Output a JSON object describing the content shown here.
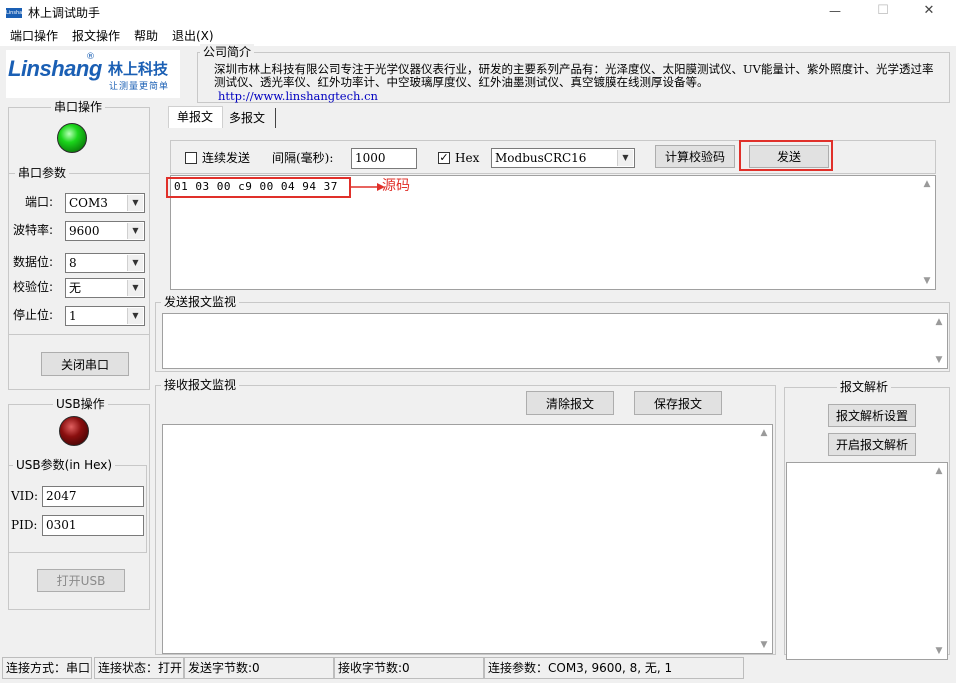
{
  "window": {
    "title": "林上调试助手",
    "logo_tiny": "Linshang",
    "controls": {
      "minimize": "—",
      "maximize": "☐",
      "close": "✕"
    }
  },
  "menu": {
    "items": [
      "端口操作",
      "报文操作",
      "帮助",
      "退出(X)"
    ]
  },
  "brand": {
    "logo_text": "Linshang",
    "registered": "®",
    "cn_name": "林上科技",
    "slogan": "让测量更简单"
  },
  "company": {
    "group_title": "公司简介",
    "text": "深圳市林上科技有限公司专注于光学仪器仪表行业，研发的主要系列产品有：光泽度仪、太阳膜测试仪、UV能量计、紫外照度计、光学透过率测试仪、透光率仪、红外功率计、中空玻璃厚度仪、红外油墨测试仪、真空镀膜在线测厚设备等。",
    "url": "http://www.linshangtech.cn"
  },
  "serial": {
    "group_title": "串口操作",
    "params_title": "串口参数",
    "led_color": "#1bd61b",
    "fields": [
      {
        "label": "端口:",
        "value": "COM3"
      },
      {
        "label": "波特率:",
        "value": "9600"
      },
      {
        "label": "数据位:",
        "value": "8"
      },
      {
        "label": "校验位:",
        "value": "无"
      },
      {
        "label": "停止位:",
        "value": "1"
      }
    ],
    "close_button": "关闭串口"
  },
  "usb": {
    "group_title": "USB操作",
    "params_title": "USB参数(in Hex)",
    "led_color": "#8a0f0f",
    "vid_label": "VID:",
    "vid_value": "2047",
    "pid_label": "PID:",
    "pid_value": "0301",
    "open_button": "打开USB"
  },
  "tabs": {
    "items": [
      "单报文",
      "多报文"
    ],
    "active": 0
  },
  "send_panel": {
    "continuous_label": "连续发送",
    "continuous_checked": false,
    "interval_label": "间隔(毫秒):",
    "interval_value": "1000",
    "hex_label": "Hex",
    "hex_checked": true,
    "crc_mode": "ModbusCRC16",
    "calc_button": "计算校验码",
    "send_button": "发送",
    "source_text": "01 03 00 c9 00 04 94 37",
    "annotation": "源码",
    "annotation_color": "#e0302a"
  },
  "send_monitor": {
    "title": "发送报文监视"
  },
  "recv_monitor": {
    "title": "接收报文监视",
    "clear_button": "清除报文",
    "save_button": "保存报文"
  },
  "parse": {
    "title": "报文解析",
    "settings_button": "报文解析设置",
    "enable_button": "开启报文解析"
  },
  "status": {
    "conn_mode": "连接方式：串口",
    "conn_state": "连接状态：打开",
    "send_bytes": "发送字节数:0",
    "recv_bytes": "接收字节数:0",
    "conn_params": "连接参数：COM3, 9600, 8, 无, 1"
  }
}
